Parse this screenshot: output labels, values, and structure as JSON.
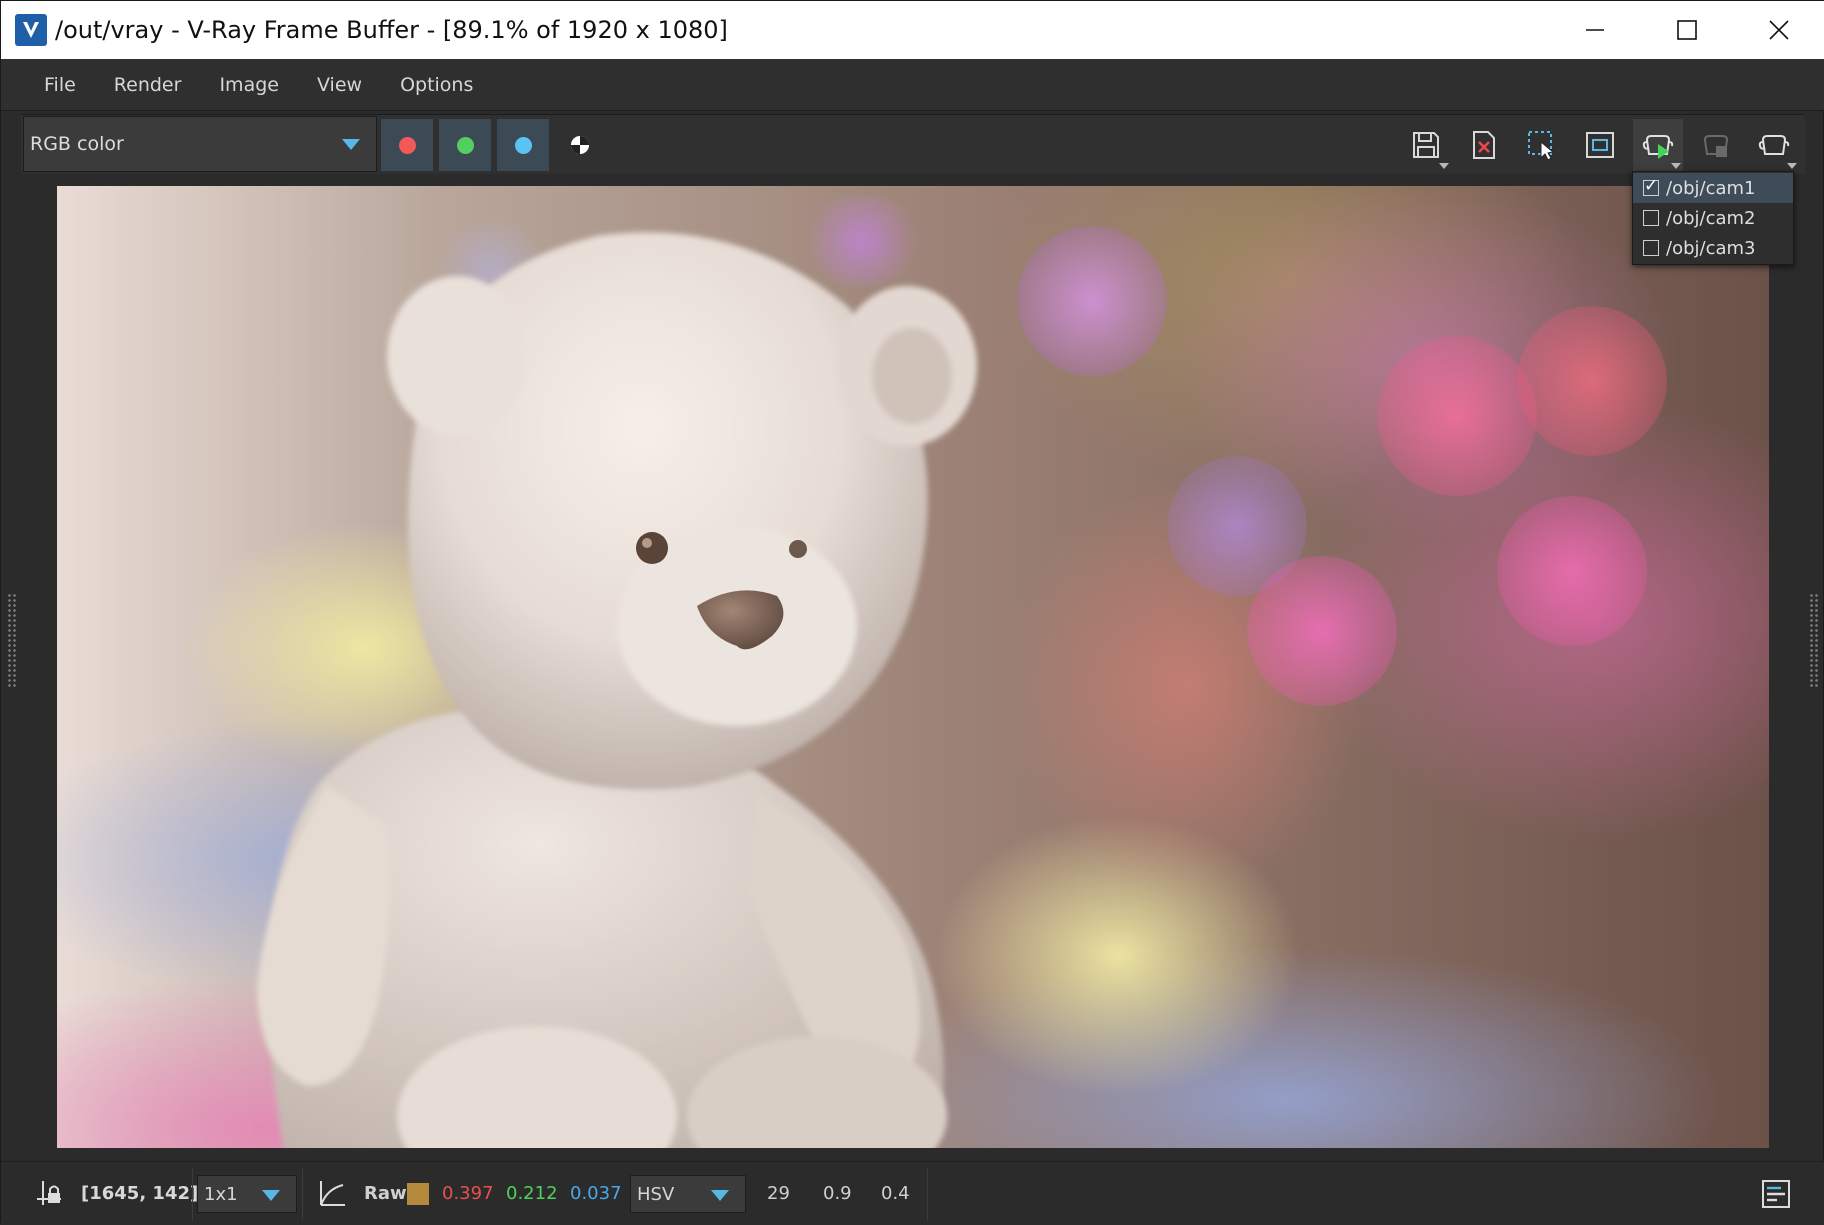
{
  "window": {
    "title": "/out/vray - V-Ray Frame Buffer - [89.1% of 1920 x 1080]",
    "logo": "vray-logo-icon",
    "controls": [
      "minimize-icon",
      "maximize-icon",
      "close-icon"
    ]
  },
  "menu": {
    "items": [
      "File",
      "Render",
      "Image",
      "View",
      "Options"
    ]
  },
  "toolbar": {
    "channel": "RGB color",
    "channel_buttons": [
      {
        "name": "red-channel",
        "color": "#f25a5a"
      },
      {
        "name": "green-channel",
        "color": "#54cf5f"
      },
      {
        "name": "blue-channel",
        "color": "#5ac3f2"
      }
    ],
    "alpha_icon": "alpha-channel-icon",
    "tools": [
      "save-icon",
      "clear-image-icon",
      "region-render-icon",
      "track-mouse-icon",
      "render-camera-icon",
      "stop-render-icon",
      "render-last-icon"
    ]
  },
  "camera_menu": {
    "items": [
      {
        "label": "/obj/cam1",
        "checked": true
      },
      {
        "label": "/obj/cam2",
        "checked": false
      },
      {
        "label": "/obj/cam3",
        "checked": false
      }
    ]
  },
  "status": {
    "coords": "[1645, 142]",
    "sample_size": "1x1",
    "mode": "Raw",
    "swatch_color": "#b58a3c",
    "r": "0.397",
    "g": "0.212",
    "b": "0.037",
    "colorspace": "HSV",
    "h": "29",
    "s": "0.9",
    "v": "0.4",
    "r_color": "#e85050",
    "g_color": "#4fd25a",
    "b_color": "#4aa8e8"
  }
}
